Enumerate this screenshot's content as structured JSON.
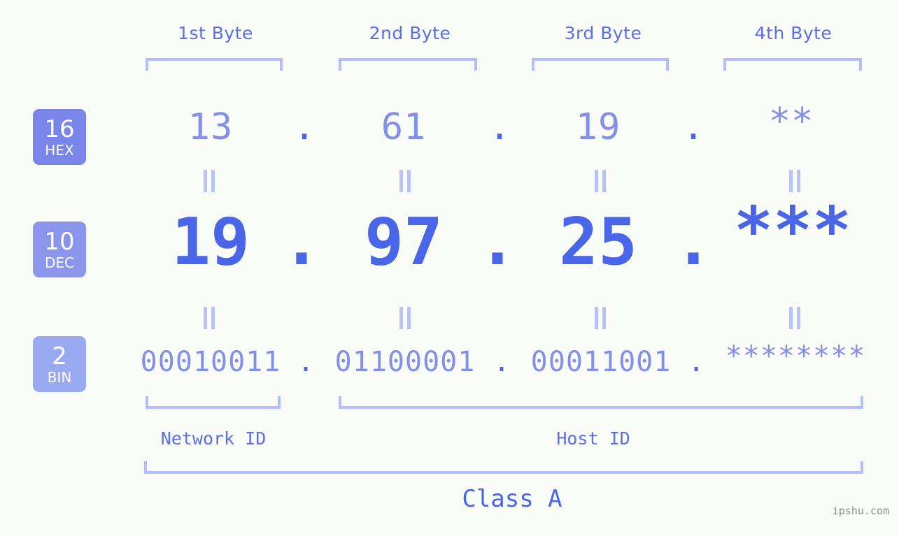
{
  "page": {
    "background_color": "#fafcf7",
    "accent_color": "#4a66e8",
    "light_accent_color": "#b4beff",
    "watermark": "ipshu.com"
  },
  "byte_headers": [
    {
      "label": "1st Byte"
    },
    {
      "label": "2nd Byte"
    },
    {
      "label": "3rd Byte"
    },
    {
      "label": "4th Byte"
    }
  ],
  "bases": [
    {
      "number": "16",
      "name": "HEX",
      "color": "#7985e8"
    },
    {
      "number": "10",
      "name": "DEC",
      "color": "#8c95ec"
    },
    {
      "number": "2",
      "name": "BIN",
      "color": "#9aaaf2"
    }
  ],
  "rows": {
    "hex": {
      "values": [
        "13",
        "61",
        "19",
        "**"
      ],
      "separator": "."
    },
    "dec": {
      "values": [
        "19",
        "97",
        "25",
        "***"
      ],
      "separator": "."
    },
    "bin": {
      "values": [
        "00010011",
        "01100001",
        "00011001",
        "********"
      ],
      "separator": "."
    }
  },
  "equals_marks": {
    "symbol": "||",
    "count_per_row": 4
  },
  "regions": [
    {
      "label": "Network ID"
    },
    {
      "label": "Host ID"
    }
  ],
  "class": {
    "label": "Class A"
  }
}
